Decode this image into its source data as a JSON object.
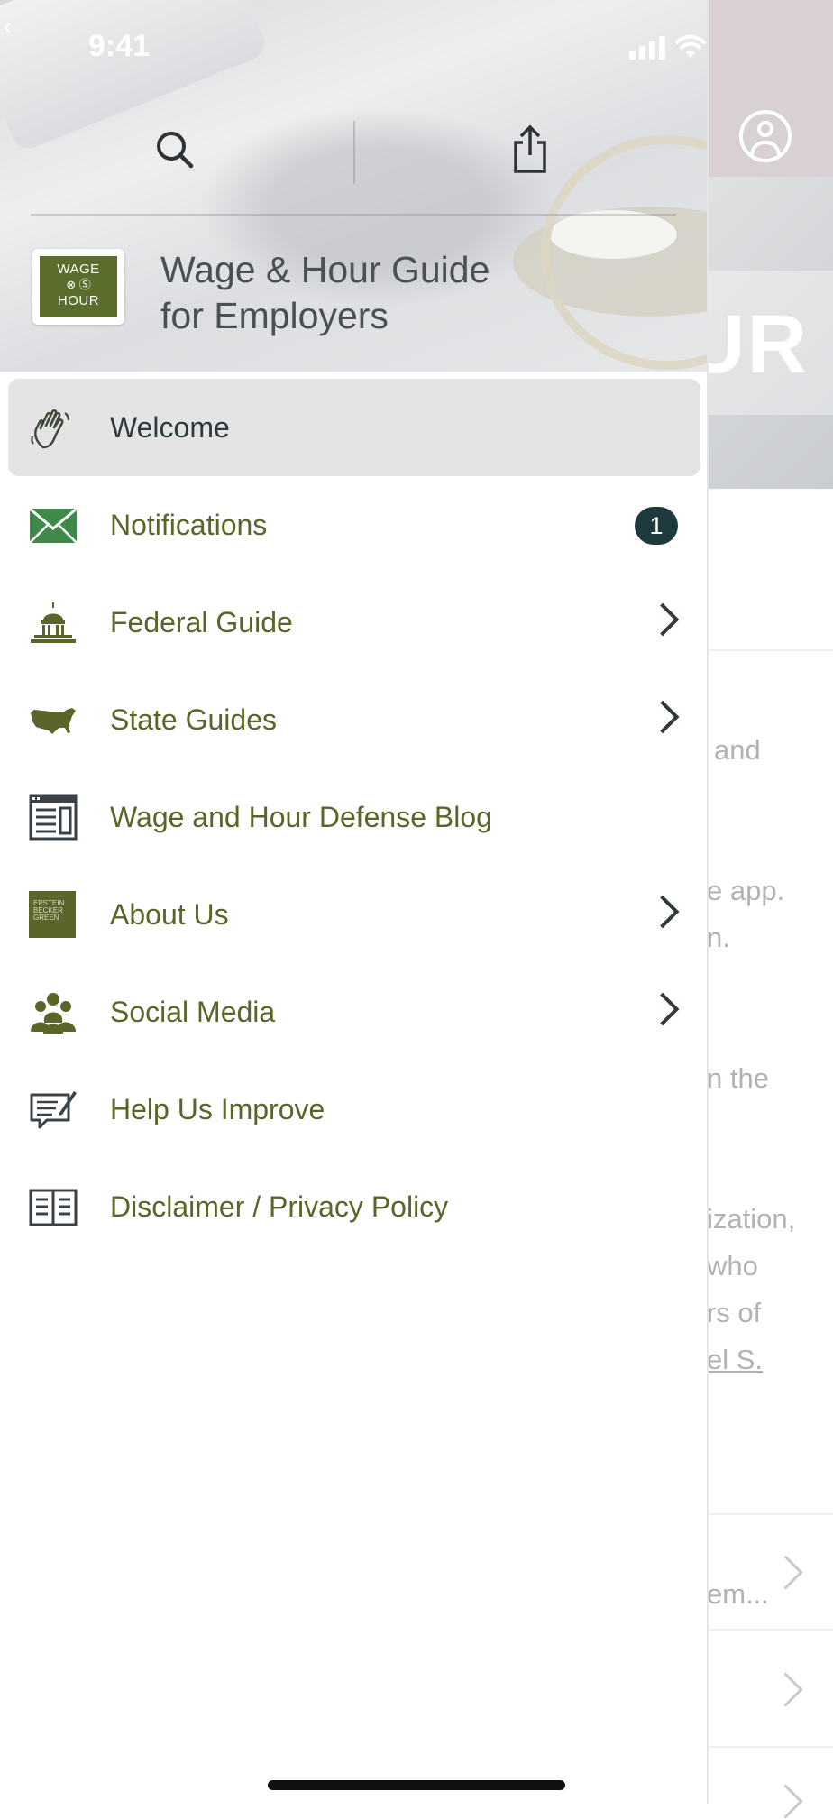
{
  "status_bar": {
    "time": "9:41"
  },
  "drawer": {
    "app_title_line1": "Wage & Hour Guide",
    "app_title_line2": "for Employers",
    "logo": {
      "line1": "WAGE",
      "line2": "HOUR"
    },
    "menu": [
      {
        "label": "Welcome",
        "icon": "hand-wave-icon",
        "active": true
      },
      {
        "label": "Notifications",
        "icon": "envelope-icon",
        "badge": "1"
      },
      {
        "label": "Federal Guide",
        "icon": "capitol-icon",
        "chevron": true
      },
      {
        "label": "State Guides",
        "icon": "us-map-icon",
        "chevron": true
      },
      {
        "label": "Wage and Hour Defense Blog",
        "icon": "newspaper-icon"
      },
      {
        "label": "About Us",
        "icon": "epstein-becker-green-logo-icon",
        "chevron": true
      },
      {
        "label": "Social Media",
        "icon": "people-group-icon",
        "chevron": true
      },
      {
        "label": "Help Us Improve",
        "icon": "feedback-form-icon"
      },
      {
        "label": "Disclaimer / Privacy Policy",
        "icon": "book-icon"
      }
    ],
    "about_icon_text": [
      "EPSTEIN",
      "BECKER",
      "GREEN"
    ]
  },
  "background": {
    "hero_text": "UR",
    "lines": [
      "and",
      "e app.",
      "n.",
      "n the",
      "ization,",
      "who",
      "rs of",
      "el S."
    ],
    "list_item_1": "em..."
  },
  "colors": {
    "olive": "#5b6429",
    "badge": "#1f3a3c",
    "active_bg": "#e4e4e4"
  }
}
